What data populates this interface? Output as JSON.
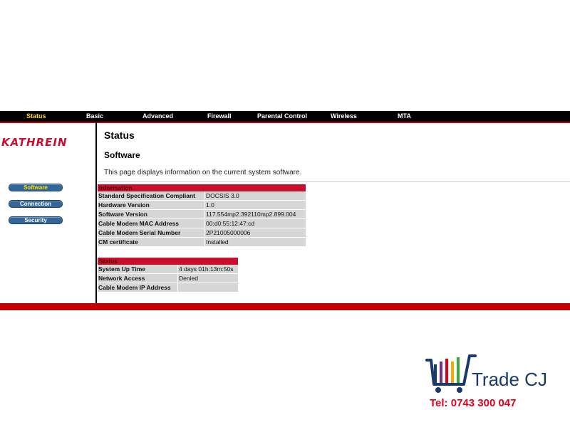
{
  "nav": {
    "items": [
      {
        "label": "Status",
        "active": true
      },
      {
        "label": "Basic"
      },
      {
        "label": "Advanced"
      },
      {
        "label": "Firewall"
      },
      {
        "label": "Parental Control"
      },
      {
        "label": "Wireless"
      },
      {
        "label": "MTA"
      }
    ]
  },
  "logo": "KATHREIN",
  "sidebar": {
    "items": [
      {
        "label": "Software",
        "active": true
      },
      {
        "label": "Connection"
      },
      {
        "label": "Security"
      }
    ]
  },
  "main": {
    "title": "Status",
    "section": "Software",
    "description": "This page displays information on the current system software."
  },
  "information": {
    "header": "Information",
    "rows": [
      {
        "label": "Standard Specification Compliant",
        "value": "DOCSIS 3.0"
      },
      {
        "label": "Hardware Version",
        "value": "1.0"
      },
      {
        "label": "Software Version",
        "value": "117.554mp2.392110mp2.899.004"
      },
      {
        "label": "Cable Modem MAC Address",
        "value": "00:d0:55:12:47:cd"
      },
      {
        "label": "Cable Modem Serial Number",
        "value": "2P21005000006"
      },
      {
        "label": "CM certificate",
        "value": "Installed"
      }
    ]
  },
  "status": {
    "header": "Status",
    "rows": [
      {
        "label": "System Up Time",
        "value": "4 days 01h:13m:50s"
      },
      {
        "label": "Network Access",
        "value": "Denied"
      },
      {
        "label": "Cable Modem IP Address",
        "value": ""
      }
    ]
  },
  "watermark": {
    "name": "Trade CJ",
    "tel": "Tel: 0743 300 047"
  },
  "colors": {
    "accent_red": "#c40000",
    "nav_bg": "#000000",
    "nav_active": "#ffd800",
    "button_blue": "#336699",
    "table_cell": "#d6d6d6"
  }
}
